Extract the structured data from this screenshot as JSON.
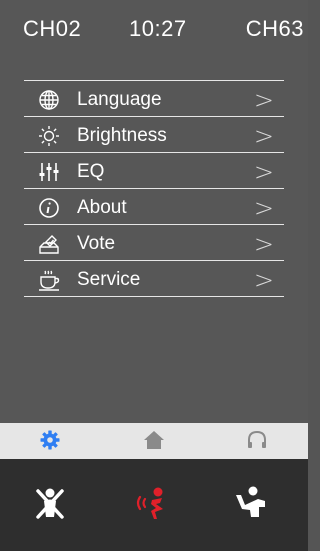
{
  "status": {
    "left_channel": "CH02",
    "time": "10:27",
    "right_channel": "CH63"
  },
  "menu": [
    {
      "label": "Language",
      "icon": "globe-icon",
      "chevron": ">"
    },
    {
      "label": "Brightness",
      "icon": "sun-icon",
      "chevron": ">"
    },
    {
      "label": "EQ",
      "icon": "equalizer-icon",
      "chevron": ">"
    },
    {
      "label": "About",
      "icon": "info-icon",
      "chevron": ">"
    },
    {
      "label": "Vote",
      "icon": "vote-icon",
      "chevron": ">"
    },
    {
      "label": "Service",
      "icon": "coffee-cup-icon",
      "chevron": ">"
    }
  ],
  "tabs": [
    {
      "name": "settings",
      "icon": "gear-icon",
      "active": true,
      "color": "#2f7ef2"
    },
    {
      "name": "home",
      "icon": "home-icon",
      "active": false,
      "color": "#8a8a8a"
    },
    {
      "name": "listen",
      "icon": "headphones-icon",
      "active": false,
      "color": "#8a8a8a"
    }
  ],
  "call_buttons": [
    {
      "name": "cancel-speak",
      "icon": "person-crossed-icon",
      "color": "#ffffff"
    },
    {
      "name": "speak",
      "icon": "speaking-person-icon",
      "color": "#e0202a"
    },
    {
      "name": "request",
      "icon": "raise-hand-icon",
      "color": "#ffffff"
    }
  ],
  "colors": {
    "background": "#575757",
    "divider": "#e6e6e6",
    "tabbar": "#e6e6e6",
    "callbar": "#2e2e2e",
    "accent": "#2f7ef2",
    "speak_active": "#e0202a"
  }
}
